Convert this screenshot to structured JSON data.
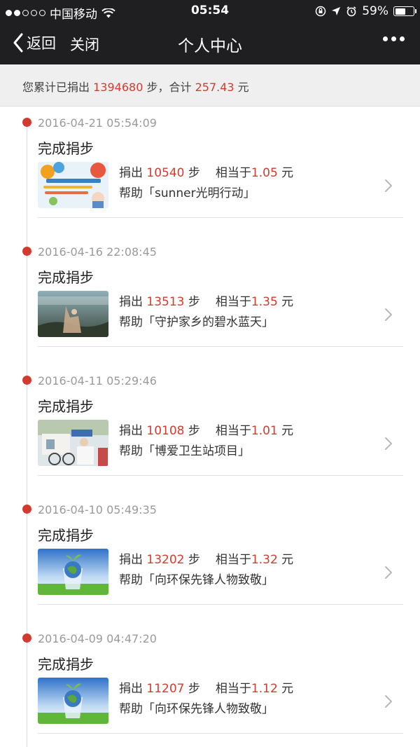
{
  "status_bar": {
    "carrier": "中国移动",
    "time": "05:54",
    "battery": "59%",
    "battery_level": 0.59,
    "signal_dots_filled": 2,
    "signal_dots_total": 5
  },
  "nav": {
    "back_label": "返回",
    "close_label": "关闭",
    "title": "个人中心"
  },
  "summary": {
    "prefix": "您累计已捐出",
    "total_steps": "1394680",
    "steps_unit_sep": "步，合计",
    "total_amount": "257.43",
    "currency": "元"
  },
  "labels": {
    "donate": "捐出",
    "steps_unit": "步",
    "equals": "相当于",
    "yuan": "元",
    "help_prefix": "帮助「",
    "help_suffix": "」"
  },
  "entries": [
    {
      "timestamp": "2016-04-21 05:54:09",
      "title": "完成捐步",
      "steps": "10540",
      "amount": "1.05",
      "project": "sunner光明行动",
      "thumb": "sunner-project-thumbnail"
    },
    {
      "timestamp": "2016-04-16 22:08:45",
      "title": "完成捐步",
      "steps": "13513",
      "amount": "1.35",
      "project": "守护家乡的碧水蓝天",
      "thumb": "blue-sky-project-thumbnail"
    },
    {
      "timestamp": "2016-04-11 05:29:46",
      "title": "完成捐步",
      "steps": "10108",
      "amount": "1.01",
      "project": "博爱卫生站项目",
      "thumb": "health-station-thumbnail"
    },
    {
      "timestamp": "2016-04-10 05:49:35",
      "title": "完成捐步",
      "steps": "13202",
      "amount": "1.32",
      "project": "向环保先锋人物致敬",
      "thumb": "eco-globe-thumbnail"
    },
    {
      "timestamp": "2016-04-09 04:47:20",
      "title": "完成捐步",
      "steps": "11207",
      "amount": "1.12",
      "project": "向环保先锋人物致敬",
      "thumb": "eco-globe-thumbnail"
    }
  ],
  "colors": {
    "bar_bg": "#1f1f22",
    "accent_red": "#d43b2f",
    "summary_bg": "#efefef",
    "muted_text": "#9a9a9a"
  }
}
